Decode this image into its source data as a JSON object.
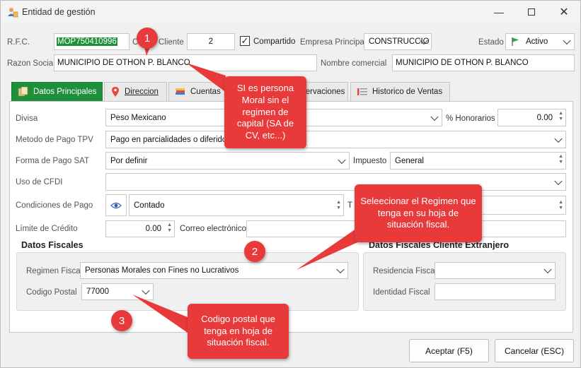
{
  "window": {
    "title": "Entidad de gestión"
  },
  "header": {
    "rfc_label": "R.F.C.",
    "rfc_value": "MOP750410996",
    "cliente_label": "Cliente",
    "cliente_prefix": "C",
    "cliente_value": "2",
    "compartido_label": "Compartido",
    "compartido_checked": true,
    "empresa_label": "Empresa Principal",
    "empresa_value": "CONSTRUCCIO",
    "estado_label": "Estado",
    "estado_value": "Activo",
    "razon_label": "Razon Social",
    "razon_value": "MUNICIPIO DE OTHON P. BLANCO",
    "nombre_label": "Nombre comercial",
    "nombre_value": "MUNICIPIO DE OTHON P. BLANCO"
  },
  "tabs": [
    {
      "label": "Datos Principales",
      "active": true
    },
    {
      "label": "Direccion",
      "active": false
    },
    {
      "label": "Cuentas",
      "active": false
    },
    {
      "label": "servaciones",
      "active": false
    },
    {
      "label": "Historico de Ventas",
      "active": false
    }
  ],
  "form": {
    "divisa_label": "Divisa",
    "divisa_value": "Peso Mexicano",
    "honorarios_label": "% Honorarios",
    "honorarios_value": "0.00",
    "metodo_label": "Metodo de Pago TPV",
    "metodo_value": "Pago en parcialidades o diferido",
    "forma_label": "Forma de Pago SAT",
    "forma_value": "Por definir",
    "impuesto_label": "Impuesto",
    "impuesto_value": "General",
    "cfdi_label": "Uso de CFDI",
    "cfdi_value": "",
    "condiciones_label": "Condiciones de Pago",
    "condiciones_value": "Contado",
    "t_label": "T",
    "limite_label": "Límite de Crédito",
    "limite_value": "0.00",
    "correo_label": "Correo electrónico",
    "correo_value": ""
  },
  "fiscal": {
    "title": "Datos Fiscales",
    "regimen_label": "Regimen Fiscal",
    "regimen_value": "Personas Morales con Fines no Lucrativos",
    "cp_label": "Codigo Postal",
    "cp_value": "77000"
  },
  "fiscal_ext": {
    "title": "Datos Fiscales Cliente Extranjero",
    "residencia_label": "Residencia Fiscal",
    "residencia_value": "",
    "identidad_label": "Identidad Fiscal",
    "identidad_value": ""
  },
  "buttons": {
    "accept": "Aceptar (F5)",
    "cancel": "Cancelar (ESC)"
  },
  "annotations": {
    "badge1": "1",
    "badge2": "2",
    "badge3": "3",
    "callout1": "SI es persona Moral sin el regimen de capital (SA de CV, etc...)",
    "callout2": "Seleecionar el Regimen que tenga en su hoja de situación fiscal.",
    "callout3": "Codigo postal que tenga en hoja de situación fiscal."
  },
  "colors": {
    "accent_green": "#1e8f3a",
    "annotation_red": "#e83a3a"
  }
}
